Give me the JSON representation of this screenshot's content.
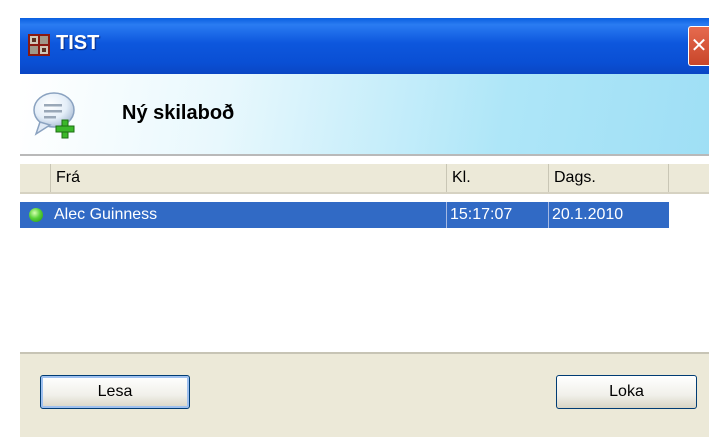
{
  "window": {
    "title": "TIST",
    "close_glyph": "✕"
  },
  "header": {
    "title": "Ný skilaboð",
    "icon": "new-message-icon"
  },
  "table": {
    "columns": [
      "Frá",
      "Kl.",
      "Dags."
    ],
    "rows": [
      {
        "from": "Alec Guinness",
        "time": "15:17:07",
        "date": "20.1.2010",
        "status": "online"
      }
    ]
  },
  "buttons": {
    "read": "Lesa",
    "close": "Loka"
  },
  "colors": {
    "titlebar": "#0a4fd4",
    "selection": "#316ac5",
    "status_online": "#59d23a"
  }
}
